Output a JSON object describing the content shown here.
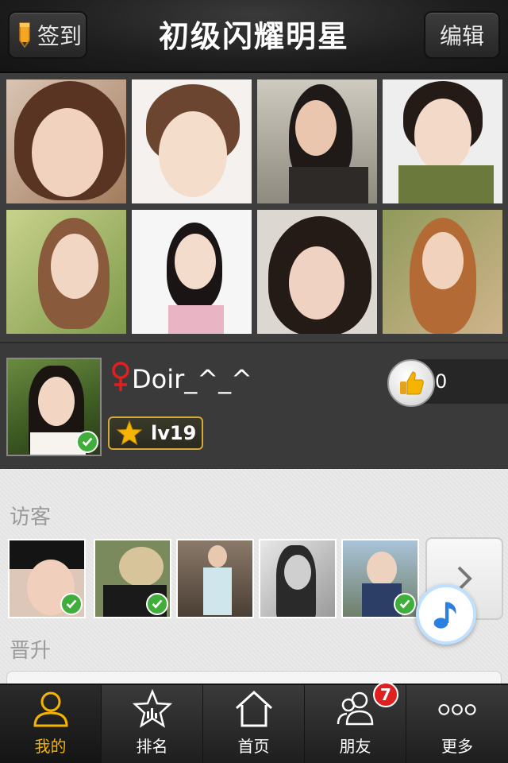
{
  "header": {
    "checkin_label": "签到",
    "title": "初级闪耀明星",
    "edit_label": "编辑"
  },
  "profile": {
    "username": "Doir_^_^",
    "level": "lv19",
    "like_count": "0",
    "gender_icon": "female-icon",
    "avatar_verified": true
  },
  "visitors": {
    "label": "访客",
    "items": [
      {
        "verified": true
      },
      {
        "verified": true
      },
      {
        "verified": false
      },
      {
        "verified": false
      },
      {
        "verified": true
      }
    ]
  },
  "promotion": {
    "label": "晋升"
  },
  "tabs": [
    {
      "label": "我的",
      "icon": "person-icon",
      "active": true
    },
    {
      "label": "排名",
      "icon": "star-ranking-icon",
      "active": false
    },
    {
      "label": "首页",
      "icon": "home-icon",
      "active": false
    },
    {
      "label": "朋友",
      "icon": "friends-icon",
      "active": false,
      "badge": "7"
    },
    {
      "label": "更多",
      "icon": "more-icon",
      "active": false
    }
  ],
  "colors": {
    "accent": "#f5b400",
    "verified": "#3fae3a",
    "badge": "#e02020",
    "female": "#e02020"
  }
}
